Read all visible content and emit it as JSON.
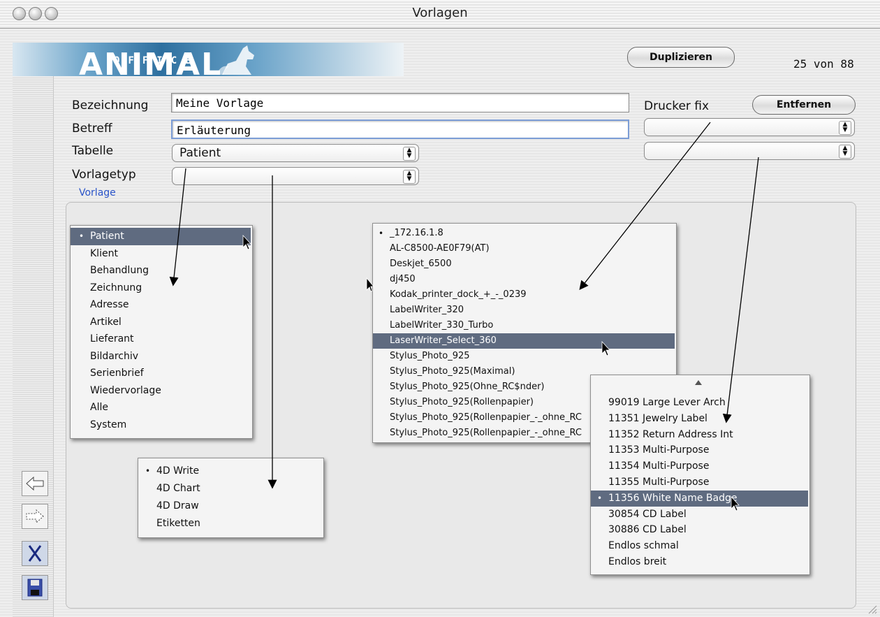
{
  "window": {
    "title": "Vorlagen"
  },
  "banner": {
    "office": "OFFICE",
    "animal": "ANIMAL"
  },
  "header": {
    "duplicate_label": "Duplizieren",
    "counter": "25 von 88"
  },
  "form": {
    "bezeichnung_label": "Bezeichnung",
    "bezeichnung_value": "Meine Vorlage",
    "betreff_label": "Betreff",
    "betreff_value": "Erläuterung",
    "tabelle_label": "Tabelle",
    "tabelle_value": "Patient",
    "vorlagetyp_label": "Vorlagetyp",
    "vorlagetyp_value": "",
    "vorlage_sublabel": "Vorlage",
    "drucker_label": "Drucker fix",
    "entfernen_label": "Entfernen",
    "drucker_value": "",
    "format_value": ""
  },
  "menus": {
    "tabelle": {
      "selected": "Patient",
      "items": [
        "Patient",
        "Klient",
        "Behandlung",
        "Zeichnung",
        "Adresse",
        "Artikel",
        "Lieferant",
        "Bildarchiv",
        "Serienbrief",
        "Wiedervorlage",
        "Alle",
        "System"
      ]
    },
    "vorlagetyp": {
      "selected": "4D Write",
      "items": [
        "4D Write",
        "4D Chart",
        "4D Draw",
        "Etiketten"
      ]
    },
    "drucker": {
      "checked": "_172.16.1.8",
      "highlighted": "LaserWriter_Select_360",
      "items": [
        "_172.16.1.8",
        "AL-C8500-AE0F79(AT)",
        "Deskjet_6500",
        "dj450",
        "Kodak_printer_dock_+_-_0239",
        "LabelWriter_320",
        "LabelWriter_330_Turbo",
        "LaserWriter_Select_360",
        "Stylus_Photo_925",
        "Stylus_Photo_925(Maximal)",
        "Stylus_Photo_925(Ohne_RC$nder)",
        "Stylus_Photo_925(Rollenpapier)",
        "Stylus_Photo_925(Rollenpapier_-_ohne_RC",
        "Stylus_Photo_925(Rollenpapier_-_ohne_RC"
      ]
    },
    "format": {
      "selected": "11356 White Name Badge",
      "items": [
        "99019 Large Lever Arch",
        "11351 Jewelry Label",
        "11352 Return Address Int",
        "11353 Multi-Purpose",
        "11354 Multi-Purpose",
        "11355 Multi-Purpose",
        "11356 White Name Badge",
        "30854 CD Label",
        "30886 CD Label",
        "Endlos schmal",
        "Endlos breit"
      ]
    }
  },
  "icons": [
    "back-arrow-icon",
    "forward-arrow-icon",
    "cancel-x-icon",
    "save-disk-icon",
    "dog-logo-icon",
    "cursor-icon",
    "scroll-up-icon",
    "resize-grip-icon"
  ]
}
